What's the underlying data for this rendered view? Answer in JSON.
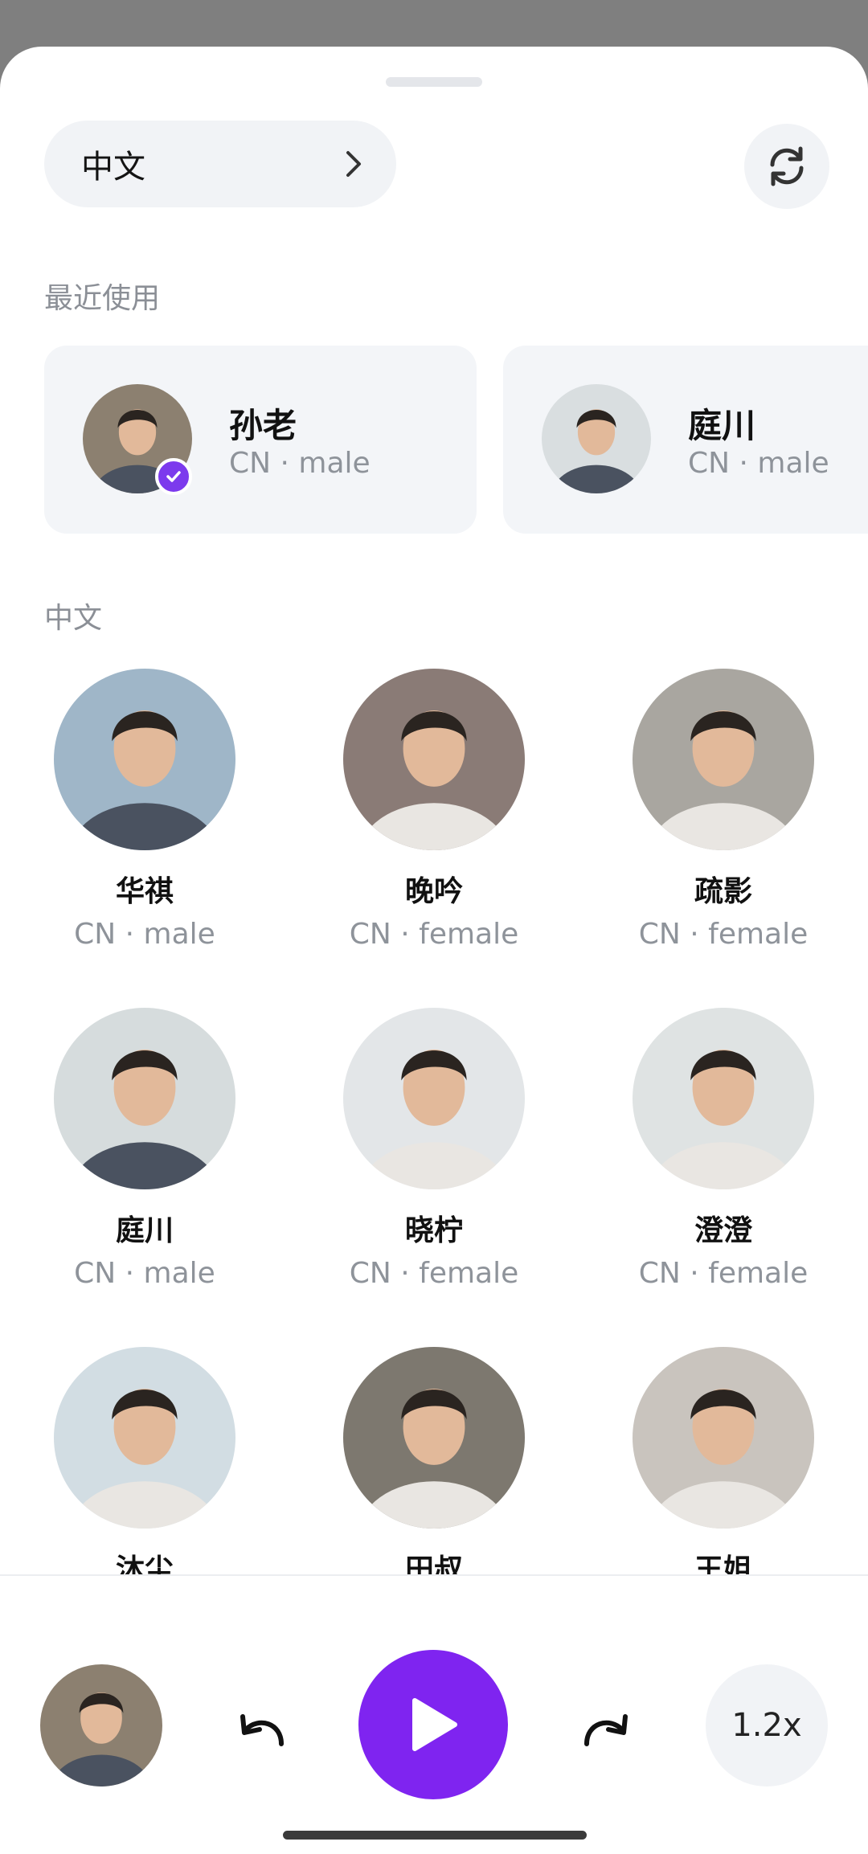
{
  "header": {
    "language_label": "中文",
    "chevron_icon": "chevron-right-icon",
    "refresh_icon": "refresh-icon"
  },
  "recent": {
    "title": "最近使用",
    "items": [
      {
        "name": "孙老",
        "meta": "CN · male",
        "selected": true,
        "avatar_tone": "#8c8070"
      },
      {
        "name": "庭川",
        "meta": "CN · male",
        "selected": false,
        "avatar_tone": "#d9dee0"
      }
    ]
  },
  "voices": {
    "title": "中文",
    "items": [
      {
        "name": "华祺",
        "meta": "CN · male",
        "avatar_tone": "#9fb6c8"
      },
      {
        "name": "晚吟",
        "meta": "CN · female",
        "avatar_tone": "#8a7b76"
      },
      {
        "name": "疏影",
        "meta": "CN · female",
        "avatar_tone": "#a9a6a0"
      },
      {
        "name": "庭川",
        "meta": "CN · male",
        "avatar_tone": "#d6dcdd"
      },
      {
        "name": "晓柠",
        "meta": "CN · female",
        "avatar_tone": "#e3e6e8"
      },
      {
        "name": "澄澄",
        "meta": "CN · female",
        "avatar_tone": "#dfe3e3"
      },
      {
        "name": "沐尘",
        "meta": "",
        "avatar_tone": "#d2dde3"
      },
      {
        "name": "田叔",
        "meta": "",
        "avatar_tone": "#7d786f"
      },
      {
        "name": "王姐",
        "meta": "",
        "avatar_tone": "#c9c4be"
      }
    ]
  },
  "player": {
    "current_avatar_tone": "#8c8070",
    "rewind_icon": "undo-arrow-icon",
    "play_icon": "play-icon",
    "forward_icon": "redo-arrow-icon",
    "speed_label": "1.2x"
  },
  "colors": {
    "accent": "#7f24f0",
    "check_badge": "#7c3aed",
    "card_bg": "#f3f5f8",
    "muted_text": "#8e939a"
  }
}
